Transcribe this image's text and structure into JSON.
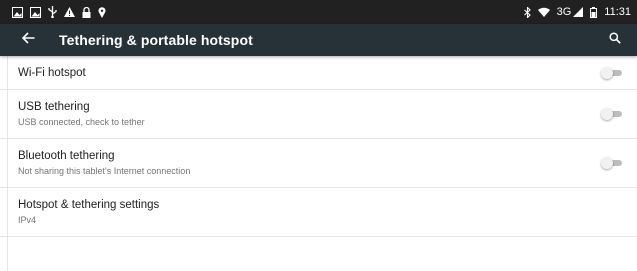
{
  "status_bar": {
    "left_icons": [
      "notification-image-icon",
      "notification-image-icon",
      "usb-icon",
      "warning-icon",
      "lock-icon",
      "location-pin-icon"
    ],
    "right_icons": [
      "bluetooth-icon",
      "wifi-icon",
      "signal-icon",
      "battery-icon"
    ],
    "network": "3G",
    "time": "11:31"
  },
  "app_bar": {
    "back_icon": "arrow-back-icon",
    "title": "Tethering & portable hotspot",
    "search_icon": "search-icon",
    "background": "#263238"
  },
  "settings": [
    {
      "title": "Wi-Fi hotspot",
      "summary": "",
      "toggle": "off"
    },
    {
      "title": "USB tethering",
      "summary": "USB connected, check to tether",
      "toggle": "off"
    },
    {
      "title": "Bluetooth tethering",
      "summary": "Not sharing this tablet's Internet connection",
      "toggle": "off"
    },
    {
      "title": "Hotspot & tethering settings",
      "summary": "IPv4"
    }
  ]
}
